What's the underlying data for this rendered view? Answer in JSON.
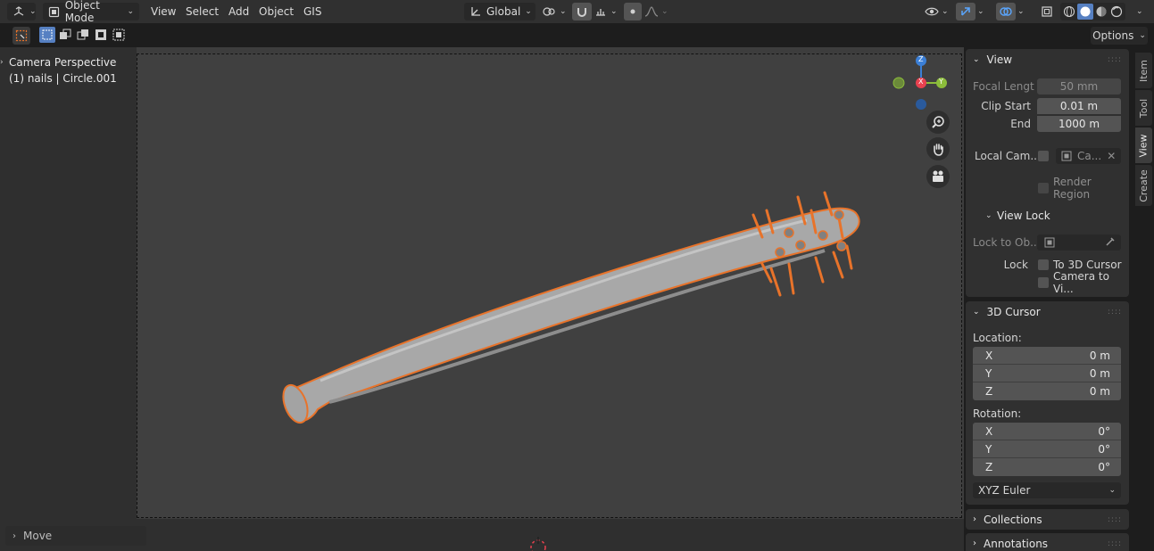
{
  "header": {
    "editor_type_icon": "3d-viewport-icon",
    "mode_label": "Object Mode",
    "menus": [
      "View",
      "Select",
      "Add",
      "Object",
      "GIS"
    ],
    "transform_orientation": "Global",
    "options_label": "Options"
  },
  "viewport": {
    "title_line1": "Camera Perspective",
    "title_line2": "(1) nails | Circle.001",
    "gizmo": {
      "z": "Z",
      "x": "X",
      "y": "Y"
    },
    "last_operator": "Move"
  },
  "sidebar": {
    "view_panel": {
      "title": "View",
      "focal_length_label": "Focal Lengt",
      "focal_length_value": "50 mm",
      "clip_start_label": "Clip Start",
      "clip_start_value": "0.01 m",
      "clip_end_label": "End",
      "clip_end_value": "1000 m",
      "local_camera_label": "Local Cam...",
      "local_camera_value": "Ca...",
      "render_region_label": "Render Region",
      "view_lock_title": "View Lock",
      "lock_to_object_label": "Lock to Ob...",
      "lock_label": "Lock",
      "to_3d_cursor_label": "To 3D Cursor",
      "camera_to_view_label": "Camera to Vi..."
    },
    "cursor_panel": {
      "title": "3D Cursor",
      "location_label": "Location:",
      "location": [
        {
          "axis": "X",
          "value": "0 m"
        },
        {
          "axis": "Y",
          "value": "0 m"
        },
        {
          "axis": "Z",
          "value": "0 m"
        }
      ],
      "rotation_label": "Rotation:",
      "rotation": [
        {
          "axis": "X",
          "value": "0°"
        },
        {
          "axis": "Y",
          "value": "0°"
        },
        {
          "axis": "Z",
          "value": "0°"
        }
      ],
      "rotation_mode": "XYZ Euler"
    },
    "collections_title": "Collections",
    "annotations_title": "Annotations"
  },
  "tabs": [
    "Item",
    "Tool",
    "View",
    "Create"
  ],
  "colors": {
    "accent_orange": "#e8732a",
    "axis_x": "#e8414f",
    "axis_y": "#8cbd3b",
    "axis_z": "#3b7fd6",
    "bat_gray": "#a8a8a8"
  }
}
